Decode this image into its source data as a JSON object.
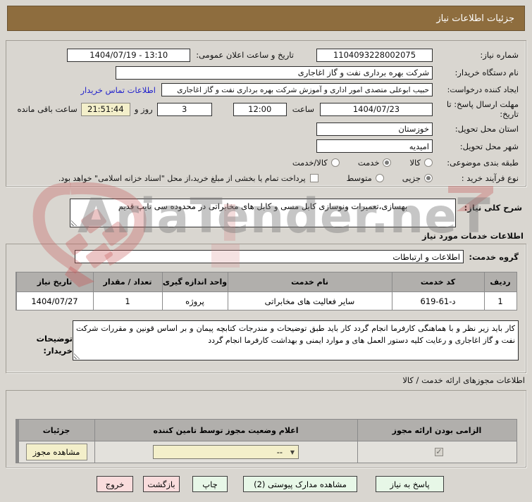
{
  "title": "جزئیات اطلاعات نیاز",
  "form": {
    "need_number_label": "شماره نیاز:",
    "need_number": "1104093228002075",
    "announce_label": "تاریخ و ساعت اعلان عمومی:",
    "announce_value": "1404/07/19 - 13:10",
    "buyer_org_label": "نام دستگاه خریدار:",
    "buyer_org": "شرکت بهره برداری نفت و گاز اغاجاری",
    "creator_label": "ایجاد کننده درخواست:",
    "creator": "حبیب ابوعلی متصدی امور اداری و آموزش شرکت بهره برداری نفت و گاز اغاجاری",
    "contact_link": "اطلاعات تماس خریدار",
    "deadline_label": "مهلت ارسال پاسخ: تا تاریخ:",
    "deadline_date": "1404/07/23",
    "hour_label": "ساعت",
    "deadline_time": "12:00",
    "days_value": "3",
    "days_label": "روز و",
    "countdown": "21:51:44",
    "remaining_label": "ساعت باقی مانده",
    "province_label": "استان محل تحویل:",
    "province": "خوزستان",
    "city_label": "شهر محل تحویل:",
    "city": "امیدیه",
    "classification_label": "طبقه بندی موضوعی:",
    "class_goods": "کالا",
    "class_service": "خدمت",
    "class_both": "کالا/خدمت",
    "classification_selected": "خدمت",
    "process_label": "نوع فرآیند خرید :",
    "process_partial": "جزیی",
    "process_medium": "متوسط",
    "process_selected": "جزیی",
    "treasury_note": "پرداخت تمام یا بخشی از مبلغ خرید،از محل \"اسناد خزانه اسلامی\" خواهد بود.",
    "treasury_checked": false
  },
  "description": {
    "label": "شرح کلی نیاز:",
    "value": "بهسازی،تعمیرات ونوسازی کابل مسی و کابل های مخابراتی در محدوده سی تایپ قدیم"
  },
  "services": {
    "heading": "اطلاعات خدمات مورد نیاز",
    "group_label": "گروه خدمت:",
    "group_value": "اطلاعات و ارتباطات",
    "table": {
      "headers": [
        "ردیف",
        "کد خدمت",
        "نام خدمت",
        "واحد اندازه گیری",
        "تعداد / مقدار",
        "تاریخ نیاز"
      ],
      "row": {
        "index": "1",
        "code": "619-61-د",
        "name": "سایر فعالیت های مخابراتی",
        "unit": "پروژه",
        "qty": "1",
        "date": "1404/07/27"
      }
    },
    "notes_label": "توضیحات خریدار:",
    "notes": "کار باید زیر نظر و با هماهنگی کارفرما انجام گردد کار باید طبق توضیحات و مندرجات کتابچه پیمان و بر اساس قونین و مقررات شرکت نفت و گاز اغاجاری و رعایت کلیه دستور العمل های و موارد ایمنی و بهداشت  کارفرما انجام گردد"
  },
  "licenses": {
    "heading": "اطلاعات مجوزهای ارائه خدمت / کالا",
    "headers": [
      "الزامی بودن ارائه مجوز",
      "اعلام وضعیت مجوز توسط تامین کننده",
      "جزئیات"
    ],
    "mandatory_checked": true,
    "status_value": "--",
    "details_button": "مشاهده مجوز"
  },
  "footer": {
    "buttons": [
      {
        "label": "پاسخ به نیاز",
        "style": "green"
      },
      {
        "label": "مشاهده مدارک پیوستی (2)",
        "style": "green"
      },
      {
        "label": "چاپ",
        "style": "green"
      },
      {
        "label": "بازگشت",
        "style": "pink"
      },
      {
        "label": "خروج",
        "style": "pink"
      }
    ]
  },
  "watermark": {
    "text": "AriaTender.neT"
  },
  "colors": {
    "titlebar": "#8e6d3e",
    "cream": "#f3efca",
    "button_green": "#e7f7e7",
    "button_pink": "#f9dcdc",
    "link_blue": "#2222cc"
  }
}
